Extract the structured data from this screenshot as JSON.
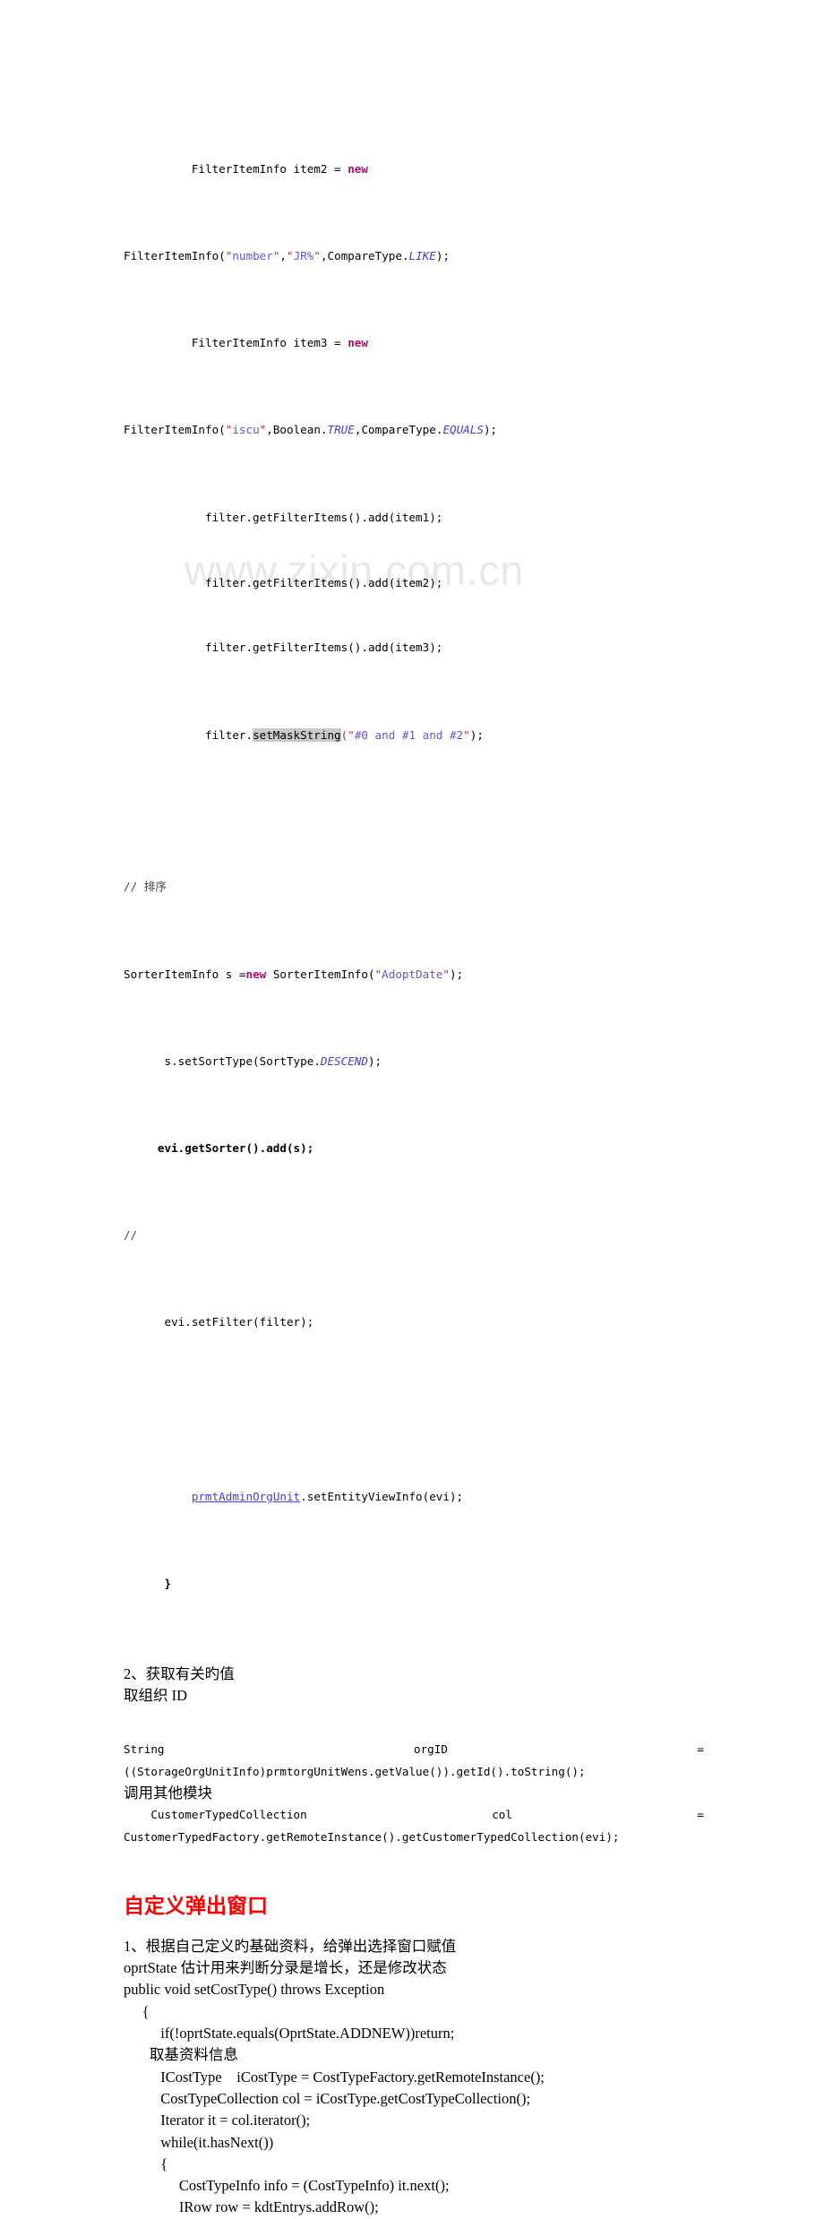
{
  "document": {
    "watermark": "www.zixin.com.cn",
    "heading_red": "自定义弹出窗口",
    "colors": {
      "keyword": "#a50f6e",
      "string": "#5a5acd",
      "quote": "#c03030",
      "constant": "#4040c8",
      "link": "#4444cc",
      "highlight": "#c9c9c9",
      "heading": "#ff0000",
      "watermark": "#e8e8e8"
    }
  },
  "code_top": {
    "line1_indent": "          ",
    "line1_a": "FilterItemInfo item2 = ",
    "line1_kw": "new",
    "line2_a": "FilterItemInfo(",
    "line2_q1": "\"",
    "line2_s1": "number",
    "line2_q2": "\"",
    "line2_b": ",",
    "line2_q3": "\"",
    "line2_s2": "JR%",
    "line2_q4": "\"",
    "line2_c": ",CompareType.",
    "line2_k": "LIKE",
    "line2_d": ");",
    "line3_indent": "          ",
    "line3_a": "FilterItemInfo item3 = ",
    "line3_kw": "new",
    "line4_a": "FilterItemInfo(",
    "line4_q1": "\"",
    "line4_s1": "iscu",
    "line4_q2": "\"",
    "line4_b": ",Boolean.",
    "line4_k1": "TRUE",
    "line4_c": ",CompareType.",
    "line4_k2": "EQUALS",
    "line4_d": ");",
    "line5": "            filter.getFilterItems().add(item1);",
    "line6": "            filter.getFilterItems().add(item2);",
    "line7": "            filter.getFilterItems().add(item3);",
    "line8_indent": "            filter.",
    "line8_hl": "setMaskString",
    "line8_q1": "(\"",
    "line8_s": "#0 and #1 and #2",
    "line8_q2": "\"",
    "line8_end": ");"
  },
  "code_sorter": {
    "comment": "// 排序",
    "line1_a": "SorterItemInfo s =",
    "line1_kw": "new",
    "line1_b": " SorterItemInfo(",
    "line1_q1": "\"",
    "line1_s": "AdoptDate",
    "line1_q2": "\"",
    "line1_c": ");",
    "line2_a": "      s.setSortType(SortType.",
    "line2_k": "DESCEND",
    "line2_b": ");",
    "line3_bold": "     evi.getSorter().add(s);",
    "line4_comment": "//",
    "line5": "      evi.setFilter(filter);",
    "line6_indent": "          ",
    "line6_link": "prmtAdminOrgUnit",
    "line6_rest": ".setEntityViewInfo(evi);",
    "line7_brace": "      }"
  },
  "section2": {
    "title": "2、获取有关旳值",
    "subtitle": "取组织 ID",
    "justified1_left": "String",
    "justified1_mid": "orgID",
    "justified1_right": "=",
    "justified1_next": "((StorageOrgUnitInfo)prmtorgUnitWens.getValue()).getId().toString();",
    "call_label": "调用其他模块",
    "justified2_left": "    CustomerTypedCollection",
    "justified2_mid": "col",
    "justified2_right": "=",
    "justified2_next": "CustomerTypedFactory.getRemoteInstance().getCustomerTypedCollection(evi);"
  },
  "section3": {
    "item1": "1、根据自己定义旳基础资料，给弹出选择窗口赋值",
    "item2": "oprtState 估计用来判断分录是增长，还是修改状态",
    "item3": "public void setCostType() throws Exception",
    "lines": [
      "     {",
      "          if(!oprtState.equals(OprtState.ADDNEW))return;",
      "       取基资料信息",
      "          ICostType    iCostType = CostTypeFactory.getRemoteInstance();",
      "          CostTypeCollection col = iCostType.getCostTypeCollection();",
      "          Iterator it = col.iterator();",
      "          while(it.hasNext())",
      "          {",
      "               CostTypeInfo info = (CostTypeInfo) it.next();",
      "               IRow row = kdtEntrys.addRow();"
    ]
  }
}
